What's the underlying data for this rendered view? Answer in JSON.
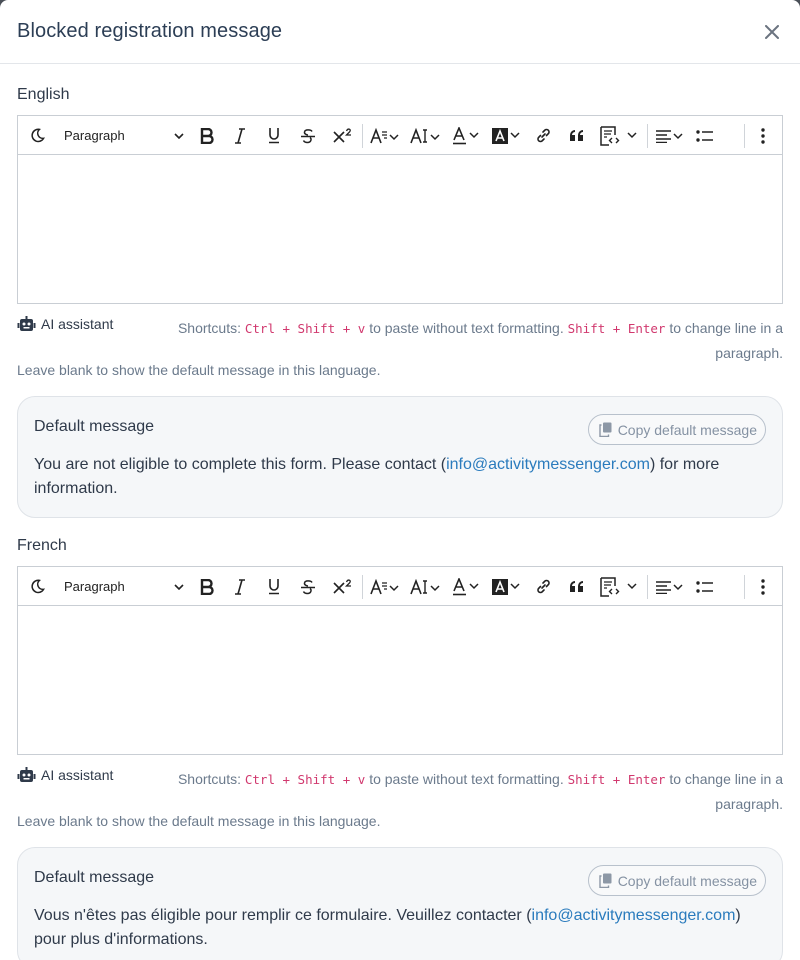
{
  "modal": {
    "title": "Blocked registration message"
  },
  "toolbar": {
    "paragraph_label": "Paragraph"
  },
  "sections": [
    {
      "language": "English",
      "ai_label": "AI assistant",
      "shortcuts": {
        "prefix": "Shortcuts:",
        "kbd1": "Ctrl + Shift + v",
        "mid": "to paste without text formatting.",
        "kbd2": "Shift + Enter",
        "suffix": "to change line in a paragraph."
      },
      "hint": "Leave blank to show the default message in this language.",
      "default_title": "Default message",
      "copy_label": "Copy default message",
      "default_text_before": "You are not eligible to complete this form. Please contact (",
      "email": "info@activitymessenger.com",
      "default_text_after": ") for more information."
    },
    {
      "language": "French",
      "ai_label": "AI assistant",
      "shortcuts": {
        "prefix": "Shortcuts:",
        "kbd1": "Ctrl + Shift + v",
        "mid": "to paste without text formatting.",
        "kbd2": "Shift + Enter",
        "suffix": "to change line in a paragraph."
      },
      "hint": "Leave blank to show the default message in this language.",
      "default_title": "Default message",
      "copy_label": "Copy default message",
      "default_text_before": "Vous n'êtes pas éligible pour remplir ce formulaire. Veuillez contacter (",
      "email": "info@activitymessenger.com",
      "default_text_after": ") pour plus d'informations."
    }
  ],
  "colors": {
    "title": "#2c3e55",
    "muted": "#6b7a8c",
    "kbd": "#d1386e",
    "link": "#2a7bbd",
    "box_bg": "#f5f7f9"
  }
}
